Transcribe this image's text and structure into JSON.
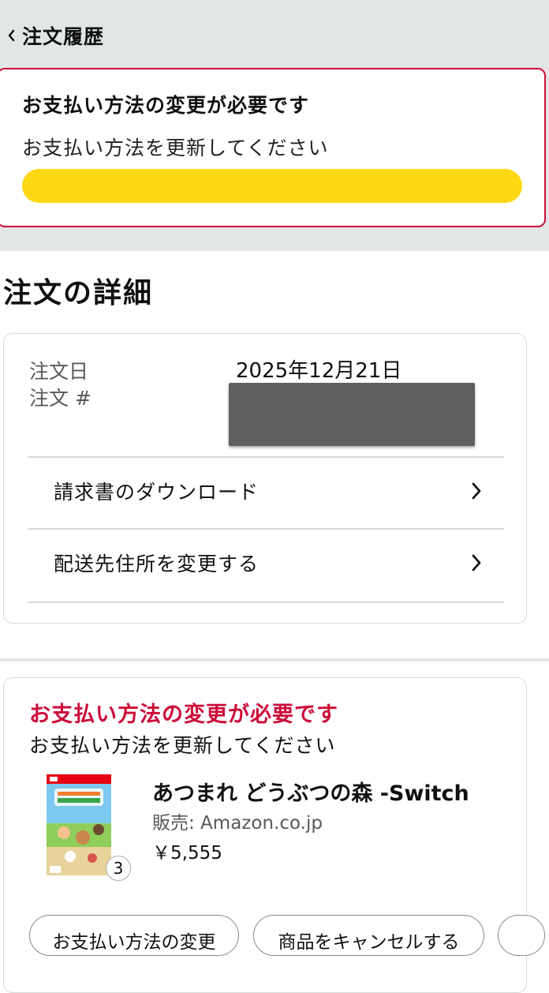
{
  "header": {
    "back_title": "注文履歴"
  },
  "alert_banner": {
    "heading": "お支払い方法の変更が必要です",
    "subtext": "お支払い方法を更新してください",
    "button_color": "#ffd814",
    "border_color": "#cc0c39"
  },
  "order_details": {
    "title": "注文の詳細",
    "order_date_label": "注文日",
    "order_date_value": "2025年12月21日",
    "order_number_label": "注文 #",
    "links": [
      {
        "label": "請求書のダウンロード"
      },
      {
        "label": "配送先住所を変更する"
      }
    ]
  },
  "shipment": {
    "alert": "お支払い方法の変更が必要です",
    "subtext": "お支払い方法を更新してください",
    "product": {
      "title": "あつまれ どうぶつの森 -Switch",
      "seller": "販売: Amazon.co.jp",
      "price": "￥5,555",
      "quantity": "3"
    },
    "actions": [
      {
        "label": "お支払い方法の変更"
      },
      {
        "label": "商品をキャンセルする"
      }
    ]
  },
  "icons": {
    "back": "chevron-left-icon",
    "row": "chevron-right-icon"
  }
}
